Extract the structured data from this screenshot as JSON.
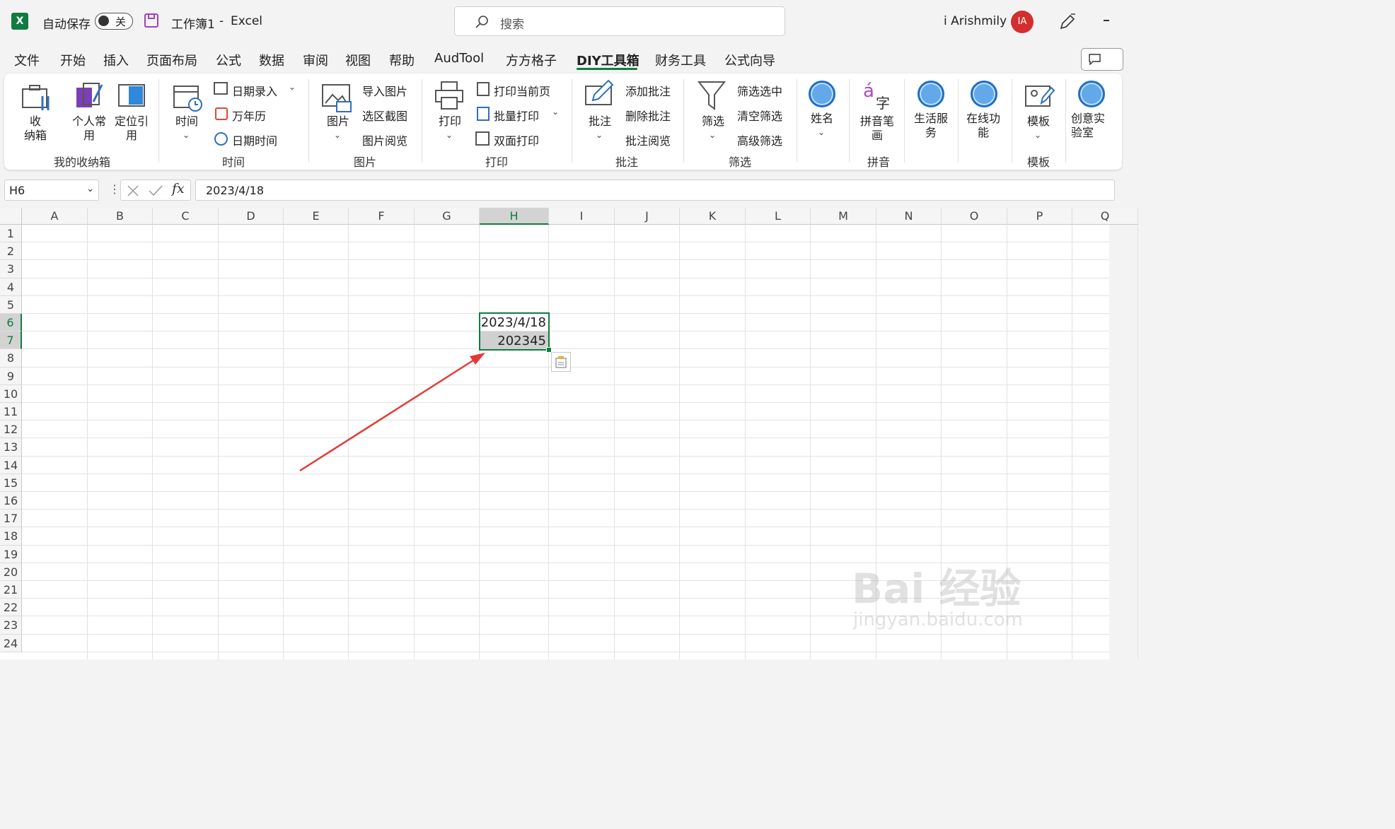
{
  "titlebar": {
    "app_logo": "X",
    "autosave_label": "自动保存",
    "autosave_state": "关",
    "workbook_name": "工作簿1",
    "separator": "-",
    "app_name": "Excel",
    "search_placeholder": "搜索",
    "user_name": "i Arishmily",
    "avatar_initials": "IA"
  },
  "menu": {
    "tabs": [
      "文件",
      "开始",
      "插入",
      "页面布局",
      "公式",
      "数据",
      "审阅",
      "视图",
      "帮助",
      "AudTool",
      "方方格子",
      "DIY工具箱",
      "财务工具",
      "公式向导"
    ],
    "active_tab": "DIY工具箱"
  },
  "ribbon": {
    "storage": {
      "btn1": "收\n纳箱",
      "btn2": "个人常\n用",
      "btn3": "定位引\n用",
      "group": "我的收纳箱"
    },
    "time": {
      "big": "时间",
      "s1": "日期录入",
      "s2": "万年历",
      "s3": "日期时间",
      "group": "时间"
    },
    "picture": {
      "big": "图片",
      "s1": "导入图片",
      "s2": "选区截图",
      "s3": "图片阅览",
      "group": "图片"
    },
    "print": {
      "big": "打印",
      "s1": "打印当前页",
      "s2": "批量打印",
      "s3": "双面打印",
      "group": "打印"
    },
    "comment": {
      "big": "批注",
      "s1": "添加批注",
      "s2": "删除批注",
      "s3": "批注阅览",
      "group": "批注"
    },
    "filter": {
      "big": "筛选",
      "s1": "筛选选中",
      "s2": "清空筛选",
      "s3": "高级筛选",
      "group": "筛选"
    },
    "name": {
      "big": "姓名"
    },
    "pinyin": {
      "big": "拼音笔\n画",
      "group": "拼音",
      "glyph1": "á",
      "glyph2": "字"
    },
    "life": {
      "big": "生活服\n务"
    },
    "online": {
      "big": "在线功\n能"
    },
    "template": {
      "big": "模板",
      "group": "模板"
    },
    "lab": {
      "big": "创意实\n验室"
    }
  },
  "formula_bar": {
    "name_box": "H6",
    "fx": "fx",
    "value": "2023/4/18"
  },
  "sheet": {
    "columns": [
      "A",
      "B",
      "C",
      "D",
      "E",
      "F",
      "G",
      "H",
      "I",
      "J",
      "K",
      "L",
      "M",
      "N",
      "O",
      "P",
      "Q"
    ],
    "rows": [
      "1",
      "2",
      "3",
      "4",
      "5",
      "6",
      "7",
      "8",
      "9",
      "10",
      "11",
      "12",
      "13",
      "14",
      "15",
      "16",
      "17",
      "18",
      "19",
      "20",
      "21",
      "22",
      "23",
      "24"
    ],
    "selected_column": "H",
    "cells": {
      "H6": "2023/4/18",
      "H7": "202345"
    }
  },
  "watermark": {
    "brand": "Bai 经验",
    "url": "jingyan.baidu.com"
  },
  "colors": {
    "accent": "#107c41",
    "arrow": "#e53935",
    "avatar": "#d32f2f"
  }
}
